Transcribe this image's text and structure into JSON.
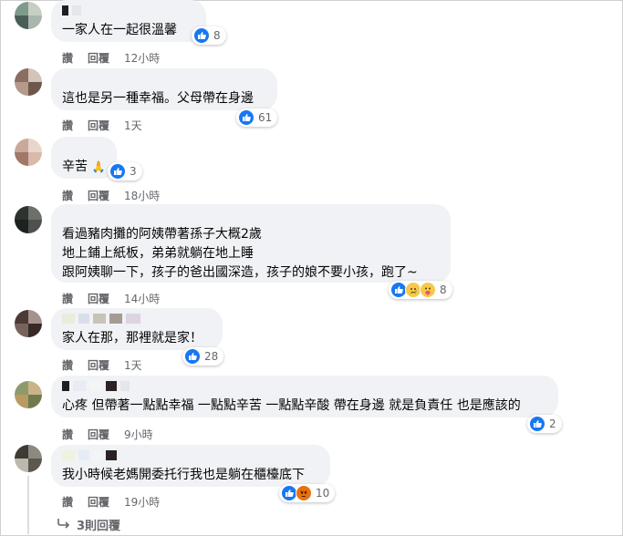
{
  "comments": [
    {
      "text_lines": [
        "一家人在一起很溫馨"
      ],
      "reaction_count": "8",
      "actions": {
        "like": "讚",
        "reply": "回覆",
        "time": "12小時"
      }
    },
    {
      "text_lines": [
        "這也是另一種幸福。父母帶在身邊"
      ],
      "reaction_count": "61",
      "actions": {
        "like": "讚",
        "reply": "回覆",
        "time": "1天"
      }
    },
    {
      "text_lines": [
        "辛苦"
      ],
      "reaction_count": "3",
      "actions": {
        "like": "讚",
        "reply": "回覆",
        "time": "18小時"
      }
    },
    {
      "text_lines": [
        "看過豬肉攤的阿姨帶著孫子大概2歲",
        "地上鋪上紙板，弟弟就躺在地上睡",
        "跟阿姨聊一下，孩子的爸出國深造，孩子的娘不要小孩，跑了~"
      ],
      "reaction_count": "8",
      "actions": {
        "like": "讚",
        "reply": "回覆",
        "time": "14小時"
      }
    },
    {
      "text_lines": [
        "家人在那，那裡就是家！"
      ],
      "reaction_count": "28",
      "actions": {
        "like": "讚",
        "reply": "回覆",
        "time": "1天"
      }
    },
    {
      "text_lines": [
        "心疼 但帶著一點點幸福 一點點辛苦 一點點辛酸 帶在身邊 就是負責任 也是應該的"
      ],
      "reaction_count": "2",
      "actions": {
        "like": "讚",
        "reply": "回覆",
        "time": "9小時"
      }
    },
    {
      "text_lines": [
        "我小時候老媽開委托行我也是躺在櫃檯底下"
      ],
      "reaction_count": "10",
      "actions": {
        "like": "讚",
        "reply": "回覆",
        "time": "19小時"
      }
    }
  ],
  "more_replies": "3則回覆",
  "icons": {
    "like": "thumbs-up-icon",
    "sad": "sad-emoji-icon",
    "care": "care-emoji-icon",
    "angry": "angry-emoji-icon",
    "reply_arrow": "reply-arrow-icon",
    "hands": "clasped-hands-emoji"
  },
  "colors": {
    "bubble": "#f0f2f5",
    "like_blue": "#1877f2",
    "meta_gray": "#65676b"
  }
}
